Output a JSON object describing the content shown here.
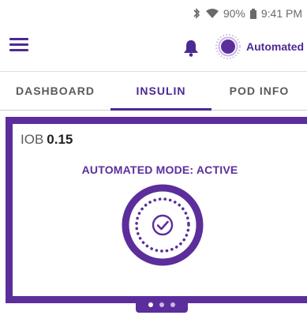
{
  "status_bar": {
    "battery": "90%",
    "time": "9:41 PM",
    "icons": [
      "bluetooth-icon",
      "wifi-icon",
      "battery-icon"
    ]
  },
  "app_bar": {
    "mode_label": "Automated",
    "icons": [
      "menu-icon",
      "bell-icon",
      "automated-mode-icon"
    ]
  },
  "tabs": [
    {
      "label": "DASHBOARD",
      "active": false
    },
    {
      "label": "INSULIN",
      "active": true
    },
    {
      "label": "POD INFO",
      "active": false
    }
  ],
  "card": {
    "iob_label": "IOB",
    "iob_value": "0.15",
    "mode_status": "AUTOMATED MODE: ACTIVE",
    "status_icon": "automated-active-check-icon"
  },
  "pager": {
    "pages": 3,
    "current": 1
  },
  "colors": {
    "brand_purple": "#5b2e9c",
    "dark_purple": "#4b2a93",
    "text_gray": "#5a5a5a"
  }
}
